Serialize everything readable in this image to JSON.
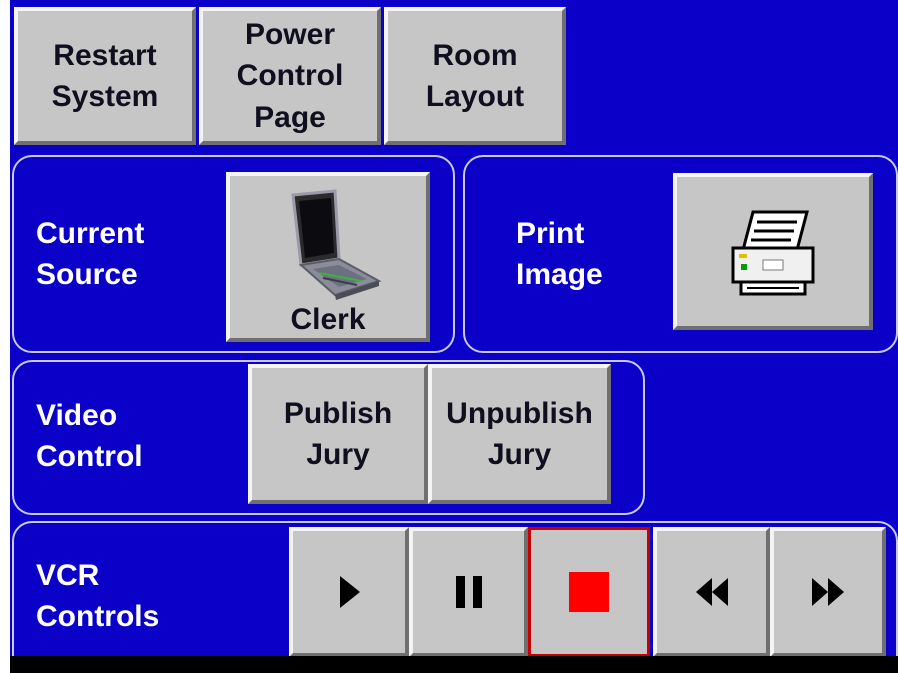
{
  "top_buttons": {
    "restart": "Restart\nSystem",
    "power": "Power\nControl\nPage",
    "room": "Room\nLayout"
  },
  "current_source": {
    "label": "Current\nSource",
    "button_label": "Clerk",
    "icon": "laptop-icon"
  },
  "print_image": {
    "label": "Print\nImage",
    "icon": "printer-icon"
  },
  "video_control": {
    "label": "Video\nControl",
    "publish": "Publish\nJury",
    "unpublish": "Unpublish\nJury"
  },
  "vcr": {
    "label": "VCR\nControls",
    "buttons": [
      {
        "icon": "play-icon"
      },
      {
        "icon": "pause-icon"
      },
      {
        "icon": "stop-icon",
        "active": true
      },
      {
        "icon": "rewind-icon"
      },
      {
        "icon": "fast-forward-icon"
      }
    ]
  },
  "colors": {
    "panel_blue": "#0a00c8",
    "button_gray": "#c6c6c6",
    "stop_red": "#ff0000"
  }
}
